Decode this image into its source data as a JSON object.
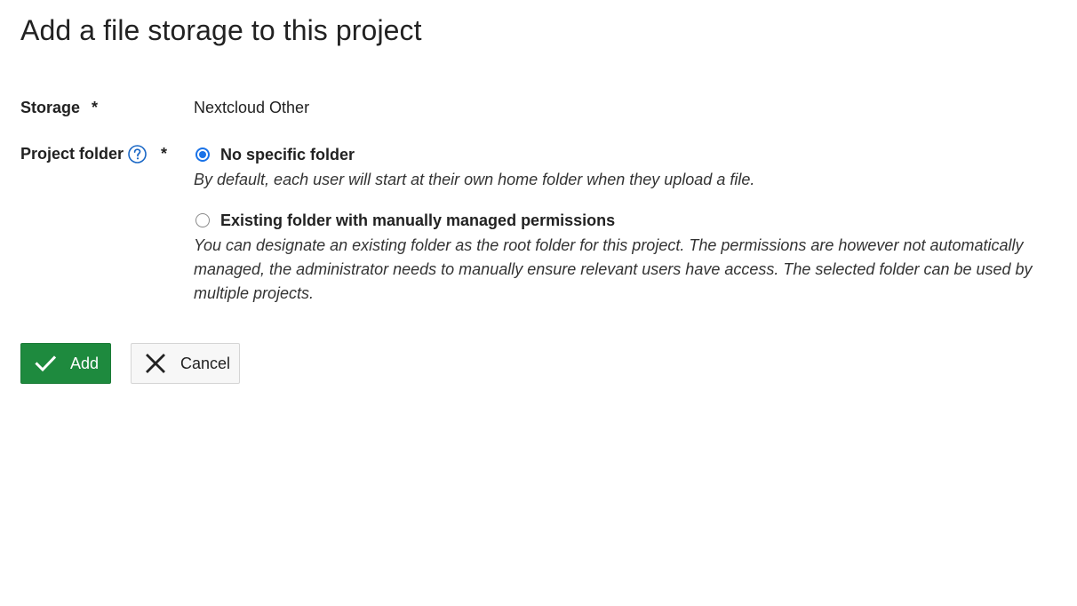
{
  "page": {
    "title": "Add a file storage to this project"
  },
  "form": {
    "storage": {
      "label": "Storage",
      "required_mark": "*",
      "value": "Nextcloud Other"
    },
    "project_folder": {
      "label": "Project folder",
      "required_mark": "*",
      "help_icon": "question-circle-icon",
      "options": [
        {
          "label": "No specific folder",
          "description": "By default, each user will start at their own home folder when they upload a file.",
          "selected": true
        },
        {
          "label": "Existing folder with manually managed permissions",
          "description": "You can designate an existing folder as the root folder for this project. The permissions are however not automatically managed, the administrator needs to manually ensure relevant users have access. The selected folder can be used by multiple projects.",
          "selected": false
        }
      ]
    }
  },
  "actions": {
    "add_label": "Add",
    "add_icon": "checkmark-icon",
    "cancel_label": "Cancel",
    "cancel_icon": "close-icon"
  },
  "colors": {
    "primary_button": "#1e8a3e",
    "radio_selected": "#1a73e8",
    "help_icon": "#1a67c5"
  }
}
